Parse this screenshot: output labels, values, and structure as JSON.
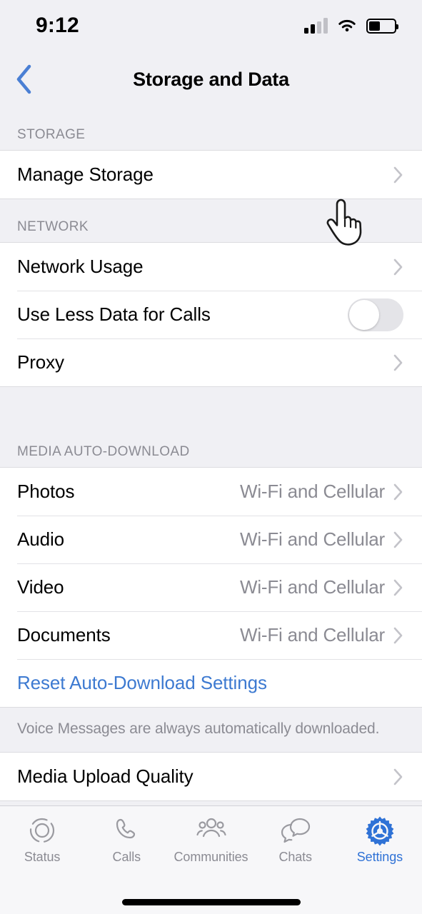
{
  "status_bar": {
    "time": "9:12",
    "signal_icon": "cellular-signal-icon",
    "signal_bars_filled": 2,
    "signal_bars_total": 4,
    "wifi_icon": "wifi-icon",
    "battery_icon": "battery-icon",
    "battery_level_percent": 45
  },
  "nav": {
    "back_icon": "chevron-left-icon",
    "title": "Storage and Data"
  },
  "colors": {
    "accent_blue": "#3d7ad1",
    "tab_active_blue": "#2f72d6",
    "group_background": "#f0f0f4",
    "row_background": "#ffffff",
    "secondary_text": "#8b8b93"
  },
  "sections": [
    {
      "header": "STORAGE",
      "rows": [
        {
          "label": "Manage Storage",
          "value": "",
          "accessory": "chevron"
        }
      ]
    },
    {
      "header": "NETWORK",
      "rows": [
        {
          "label": "Network Usage",
          "value": "",
          "accessory": "chevron"
        },
        {
          "label": "Use Less Data for Calls",
          "value": "",
          "accessory": "toggle",
          "toggle_on": false
        },
        {
          "label": "Proxy",
          "value": "",
          "accessory": "chevron"
        }
      ]
    },
    {
      "header": "MEDIA AUTO-DOWNLOAD",
      "rows": [
        {
          "label": "Photos",
          "value": "Wi-Fi and Cellular",
          "accessory": "chevron"
        },
        {
          "label": "Audio",
          "value": "Wi-Fi and Cellular",
          "accessory": "chevron"
        },
        {
          "label": "Video",
          "value": "Wi-Fi and Cellular",
          "accessory": "chevron"
        },
        {
          "label": "Documents",
          "value": "Wi-Fi and Cellular",
          "accessory": "chevron"
        },
        {
          "label": "Reset Auto-Download Settings",
          "value": "",
          "accessory": "none",
          "link": true
        }
      ],
      "footer": "Voice Messages are always automatically downloaded."
    },
    {
      "header": "",
      "rows": [
        {
          "label": "Media Upload Quality",
          "value": "",
          "accessory": "chevron"
        }
      ]
    }
  ],
  "tab_bar": {
    "items": [
      {
        "label": "Status",
        "icon": "status-ring-icon",
        "active": false
      },
      {
        "label": "Calls",
        "icon": "phone-icon",
        "active": false
      },
      {
        "label": "Communities",
        "icon": "communities-people-icon",
        "active": false
      },
      {
        "label": "Chats",
        "icon": "chat-bubbles-icon",
        "active": false
      },
      {
        "label": "Settings",
        "icon": "gear-icon",
        "active": true
      }
    ]
  },
  "cursor": {
    "icon": "pointing-hand-cursor"
  }
}
